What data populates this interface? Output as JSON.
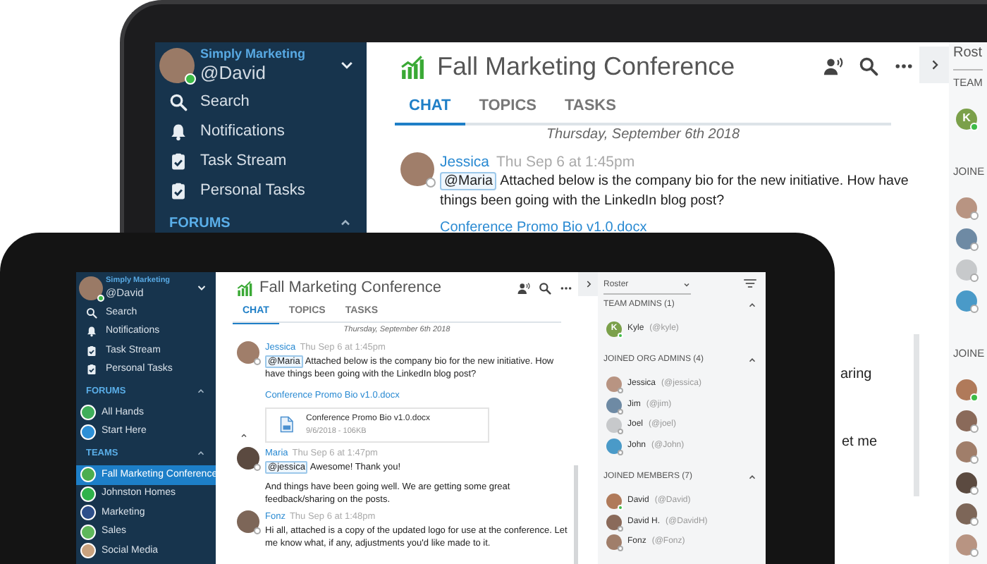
{
  "back_tablet": {
    "sidebar": {
      "workspace": "Simply Marketing",
      "user": "@David",
      "online": true,
      "nav": [
        {
          "kind": "search",
          "label": "Search"
        },
        {
          "kind": "bell",
          "label": "Notifications"
        },
        {
          "kind": "task",
          "label": "Task Stream"
        },
        {
          "kind": "task",
          "label": "Personal Tasks"
        }
      ],
      "sections": [
        {
          "heading": "FORUMS",
          "expanded": true
        }
      ]
    },
    "title": "Fall Marketing Conference",
    "tabs": [
      {
        "label": "CHAT",
        "selected": true
      },
      {
        "label": "TOPICS",
        "selected": false
      },
      {
        "label": "TASKS",
        "selected": false
      }
    ],
    "date": "Thursday, September 6th 2018",
    "messages": [
      {
        "author": "Jessica",
        "time": "Thu Sep 6 at 1:45pm",
        "online": false,
        "mention": "@Maria",
        "text": "Attached below is the company bio for the new initiative. How have things been going with the LinkedIn blog post?",
        "link": "Conference Promo Bio v1.0.docx"
      }
    ],
    "line_ends": [
      "aring",
      "et me"
    ],
    "roster": {
      "dropdown": "Rost",
      "sections": [
        {
          "heading": "TEAM",
          "members": [
            {
              "initial": "K",
              "online": true
            }
          ]
        },
        {
          "heading": "JOINE",
          "members": [
            {
              "online": false
            },
            {
              "online": false
            },
            {
              "online": false
            },
            {
              "online": false
            }
          ]
        },
        {
          "heading": "JOINE",
          "members": [
            {
              "online": true
            },
            {
              "online": false
            },
            {
              "online": false
            },
            {
              "online": false
            },
            {
              "online": false
            },
            {
              "online": false
            }
          ]
        }
      ]
    }
  },
  "front_tablet": {
    "sidebar": {
      "workspace": "Simply Marketing",
      "user": "@David",
      "online": true,
      "nav": [
        {
          "kind": "search",
          "label": "Search"
        },
        {
          "kind": "bell",
          "label": "Notifications"
        },
        {
          "kind": "task",
          "label": "Task Stream"
        },
        {
          "kind": "task",
          "label": "Personal Tasks"
        }
      ],
      "sections": [
        {
          "heading": "FORUMS",
          "expanded": true,
          "items": [
            {
              "label": "All Hands",
              "color": "#3fae5a",
              "selected": false
            },
            {
              "label": "Start Here",
              "color": "#2c8fd6",
              "selected": false
            }
          ]
        },
        {
          "heading": "TEAMS",
          "expanded": true,
          "items": [
            {
              "label": "Fall Marketing Conference",
              "color": "#4cae4f",
              "selected": true
            },
            {
              "label": "Johnston Homes",
              "color": "#2fb24a",
              "selected": false
            },
            {
              "label": "Marketing",
              "color": "#2d4f8a",
              "selected": false
            },
            {
              "label": "Sales",
              "color": "#5fb85a",
              "selected": false
            },
            {
              "label": "Social Media",
              "color": "#c9a27e",
              "selected": false
            }
          ]
        }
      ]
    },
    "title": "Fall Marketing Conference",
    "tabs": [
      {
        "label": "CHAT",
        "selected": true
      },
      {
        "label": "TOPICS",
        "selected": false
      },
      {
        "label": "TASKS",
        "selected": false
      }
    ],
    "date": "Thursday, September 6th 2018",
    "messages": [
      {
        "author": "Jessica",
        "time": "Thu Sep 6 at 1:45pm",
        "online": false,
        "mention": "@Maria",
        "text": "Attached below is the company bio for the new initiative. How have things been going with the LinkedIn blog post?",
        "link": "Conference Promo Bio v1.0.docx",
        "attachment": {
          "name": "Conference Promo Bio v1.0.docx",
          "meta": "9/6/2018 - 106KB"
        },
        "collapsible": true
      },
      {
        "author": "Maria",
        "time": "Thu Sep 6 at 1:47pm",
        "online": false,
        "mention": "@jessica",
        "text": "Awesome! Thank you!",
        "paragraphs": [
          "And things have been going well. We are getting some great feedback/sharing on the posts."
        ]
      },
      {
        "author": "Fonz",
        "time": "Thu Sep 6 at 1:48pm",
        "online": false,
        "text": "Hi all, attached is a copy of the updated logo for use at the conference. Let me know what, if any, adjustments you'd like made to it."
      }
    ],
    "roster": {
      "dropdown": "Roster",
      "sections": [
        {
          "heading": "TEAM ADMINS (1)",
          "expanded": true,
          "members": [
            {
              "name": "Kyle",
              "handle": "(@kyle)",
              "initial": "K",
              "online": true
            }
          ]
        },
        {
          "heading": "JOINED ORG ADMINS (4)",
          "expanded": true,
          "members": [
            {
              "name": "Jessica",
              "handle": "(@jessica)",
              "online": false
            },
            {
              "name": "Jim",
              "handle": "(@jim)",
              "online": false
            },
            {
              "name": "Joel",
              "handle": "(@joel)",
              "online": false
            },
            {
              "name": "John",
              "handle": "(@John)",
              "online": false
            }
          ]
        },
        {
          "heading": "JOINED MEMBERS (7)",
          "expanded": true,
          "members": [
            {
              "name": "David",
              "handle": "(@David)",
              "online": true
            },
            {
              "name": "David H.",
              "handle": "(@DavidH)",
              "online": false
            },
            {
              "name": "Fonz",
              "handle": "(@Fonz)",
              "online": false
            }
          ]
        }
      ]
    }
  }
}
